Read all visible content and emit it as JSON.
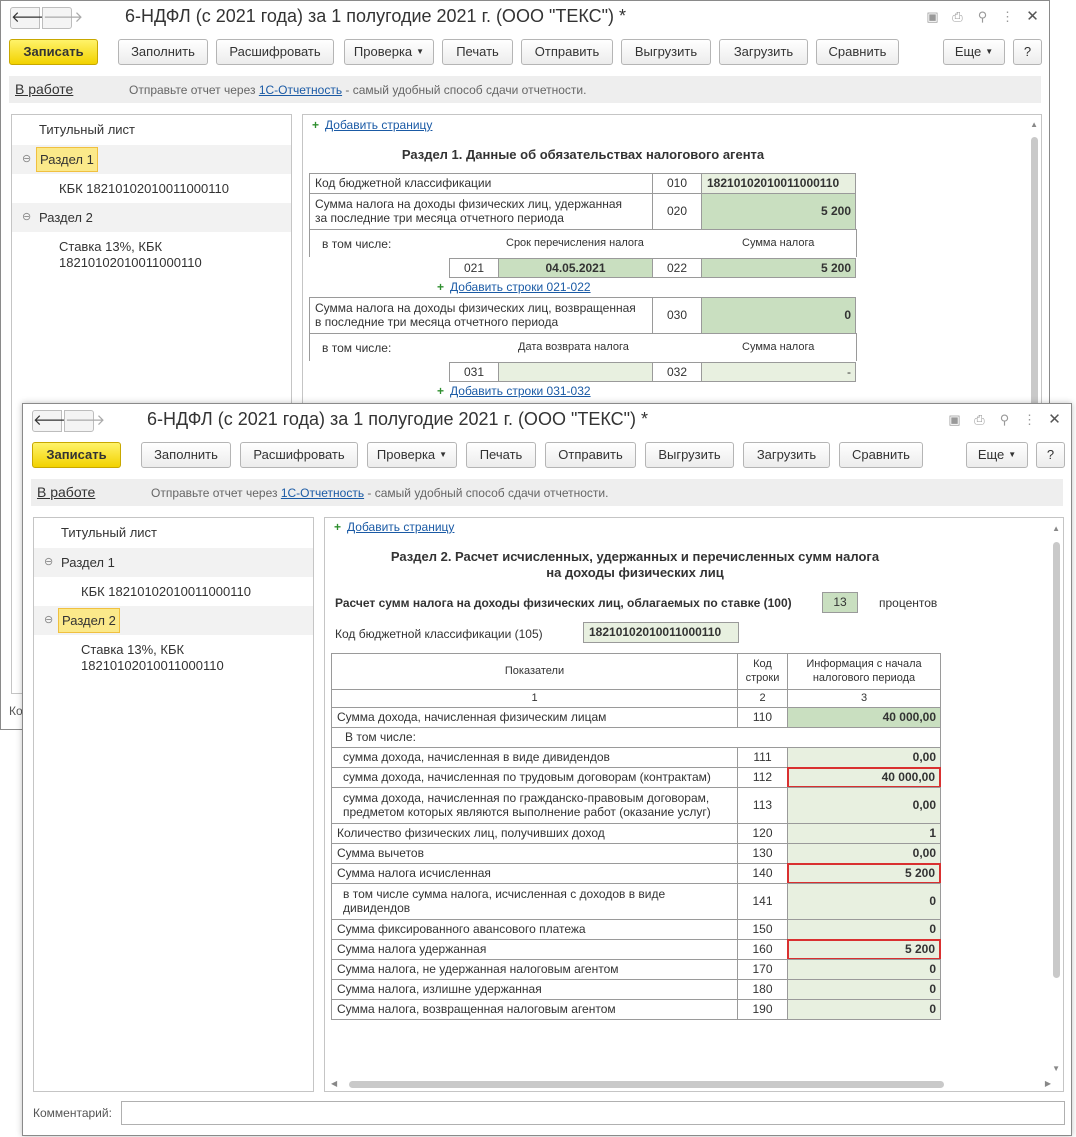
{
  "window_back": {
    "title": "6-НДФЛ (с 2021 года) за 1 полугодие 2021 г. (ООО \"ТЕКС\") *",
    "nav": {
      "back": "🡐",
      "forward": "🡒"
    },
    "titlebar_icons": [
      "save-icon",
      "print-icon",
      "preview-icon",
      "more-icon",
      "close-icon"
    ],
    "toolbar": {
      "save": "Записать",
      "fill": "Заполнить",
      "decode": "Расшифровать",
      "check": "Проверка",
      "print": "Печать",
      "send": "Отправить",
      "export": "Выгрузить",
      "import": "Загрузить",
      "compare": "Сравнить",
      "more": "Еще",
      "help": "?"
    },
    "infobar": {
      "status": "В работе",
      "msg_before": "Отправьте отчет через ",
      "msg_link": "1С-Отчетность",
      "msg_after": " - самый удобный способ сдачи отчетности."
    },
    "tree": {
      "title_sheet": "Титульный лист",
      "section1": "Раздел 1",
      "kbk": "КБК 18210102010011000110",
      "section2": "Раздел 2",
      "rate_line1": "Ставка 13%, КБК",
      "rate_line2": "18210102010011000110"
    },
    "add_page": "Добавить страницу",
    "section1": {
      "heading": "Раздел 1. Данные об обязательствах налогового агента",
      "kbk_label": "Код бюджетной классификации",
      "kbk_code": "010",
      "kbk_value": "18210102010011000110",
      "withheld_label_1": "Сумма налога на доходы физических лиц, удержанная",
      "withheld_label_2": "за последние три месяца отчетного периода",
      "withheld_code": "020",
      "withheld_value": "5 200",
      "including": "в том числе:",
      "term_header": "Срок перечисления налога",
      "sum_header": "Сумма налога",
      "row021_code": "021",
      "row021_value": "04.05.2021",
      "row022_code": "022",
      "row022_value": "5 200",
      "add_rows_021": "Добавить строки 021-022",
      "returned_label_1": "Сумма налога на доходы физических лиц, возвращенная",
      "returned_label_2": "в последние три месяца отчетного периода",
      "returned_code": "030",
      "returned_value": "0",
      "including2": "в том числе:",
      "return_date_header": "Дата возврата налога",
      "sum_header2": "Сумма налога",
      "row031_code": "031",
      "row032_code": "032",
      "row032_value": "-",
      "add_rows_031": "Добавить строки 031-032"
    },
    "bottom_label": "Ко"
  },
  "window_front": {
    "title": "6-НДФЛ (с 2021 года) за 1 полугодие 2021 г. (ООО \"ТЕКС\") *",
    "nav": {
      "back": "🡐",
      "forward": "🡒"
    },
    "toolbar": {
      "save": "Записать",
      "fill": "Заполнить",
      "decode": "Расшифровать",
      "check": "Проверка",
      "print": "Печать",
      "send": "Отправить",
      "export": "Выгрузить",
      "import": "Загрузить",
      "compare": "Сравнить",
      "more": "Еще",
      "help": "?"
    },
    "infobar": {
      "status": "В работе",
      "msg_before": "Отправьте отчет через ",
      "msg_link": "1С-Отчетность",
      "msg_after": " - самый удобный способ сдачи отчетности."
    },
    "tree": {
      "title_sheet": "Титульный лист",
      "section1": "Раздел 1",
      "kbk": "КБК 18210102010011000110",
      "section2": "Раздел 2",
      "rate_line1": "Ставка 13%, КБК",
      "rate_line2": "18210102010011000110"
    },
    "add_page": "Добавить страницу",
    "section2": {
      "heading_1": "Раздел 2. Расчет исчисленных, удержанных и перечисленных сумм налога",
      "heading_2": "на доходы физических лиц",
      "rate_label": "Расчет сумм налога на доходы физических лиц, облагаемых по ставке   (100)",
      "rate_value": "13",
      "rate_unit": "процентов",
      "kbk_label": "Код бюджетной классификации   (105)",
      "kbk_value": "18210102010011000110",
      "col_indicators": "Показатели",
      "col_code_1": "Код",
      "col_code_2": "строки",
      "col_info_1": "Информация с начала",
      "col_info_2": "налогового периода",
      "col_num_1": "1",
      "col_num_2": "2",
      "col_num_3": "3",
      "rows": [
        {
          "label": "Сумма дохода, начисленная физическим лицам",
          "code": "110",
          "value": "40 000,00"
        },
        {
          "label": "В том числе:"
        },
        {
          "label": "сумма дохода, начисленная в виде дивидендов",
          "code": "111",
          "value": "0,00"
        },
        {
          "label": "сумма дохода, начисленная по трудовым договорам (контрактам)",
          "code": "112",
          "value": "40 000,00"
        },
        {
          "label_1": "сумма дохода, начисленная по гражданско-правовым договорам,",
          "label_2": "предметом которых являются выполнение работ (оказание услуг)",
          "code": "113",
          "value": "0,00"
        },
        {
          "label": "Количество физических лиц, получивших доход",
          "code": "120",
          "value": "1"
        },
        {
          "label": "Сумма вычетов",
          "code": "130",
          "value": "0,00"
        },
        {
          "label": "Сумма налога исчисленная",
          "code": "140",
          "value": "5 200"
        },
        {
          "label_1": "в том числе сумма налога, исчисленная с доходов в виде",
          "label_2": "дивидендов",
          "code": "141",
          "value": "0"
        },
        {
          "label": "Сумма фиксированного авансового платежа",
          "code": "150",
          "value": "0"
        },
        {
          "label": "Сумма налога удержанная",
          "code": "160",
          "value": "5 200"
        },
        {
          "label": "Сумма налога, не удержанная налоговым агентом",
          "code": "170",
          "value": "0"
        },
        {
          "label": "Сумма налога, излишне удержанная",
          "code": "180",
          "value": "0"
        },
        {
          "label": "Сумма налога, возвращенная налоговым агентом",
          "code": "190",
          "value": "0"
        }
      ]
    },
    "comment_label": "Комментарий:"
  }
}
